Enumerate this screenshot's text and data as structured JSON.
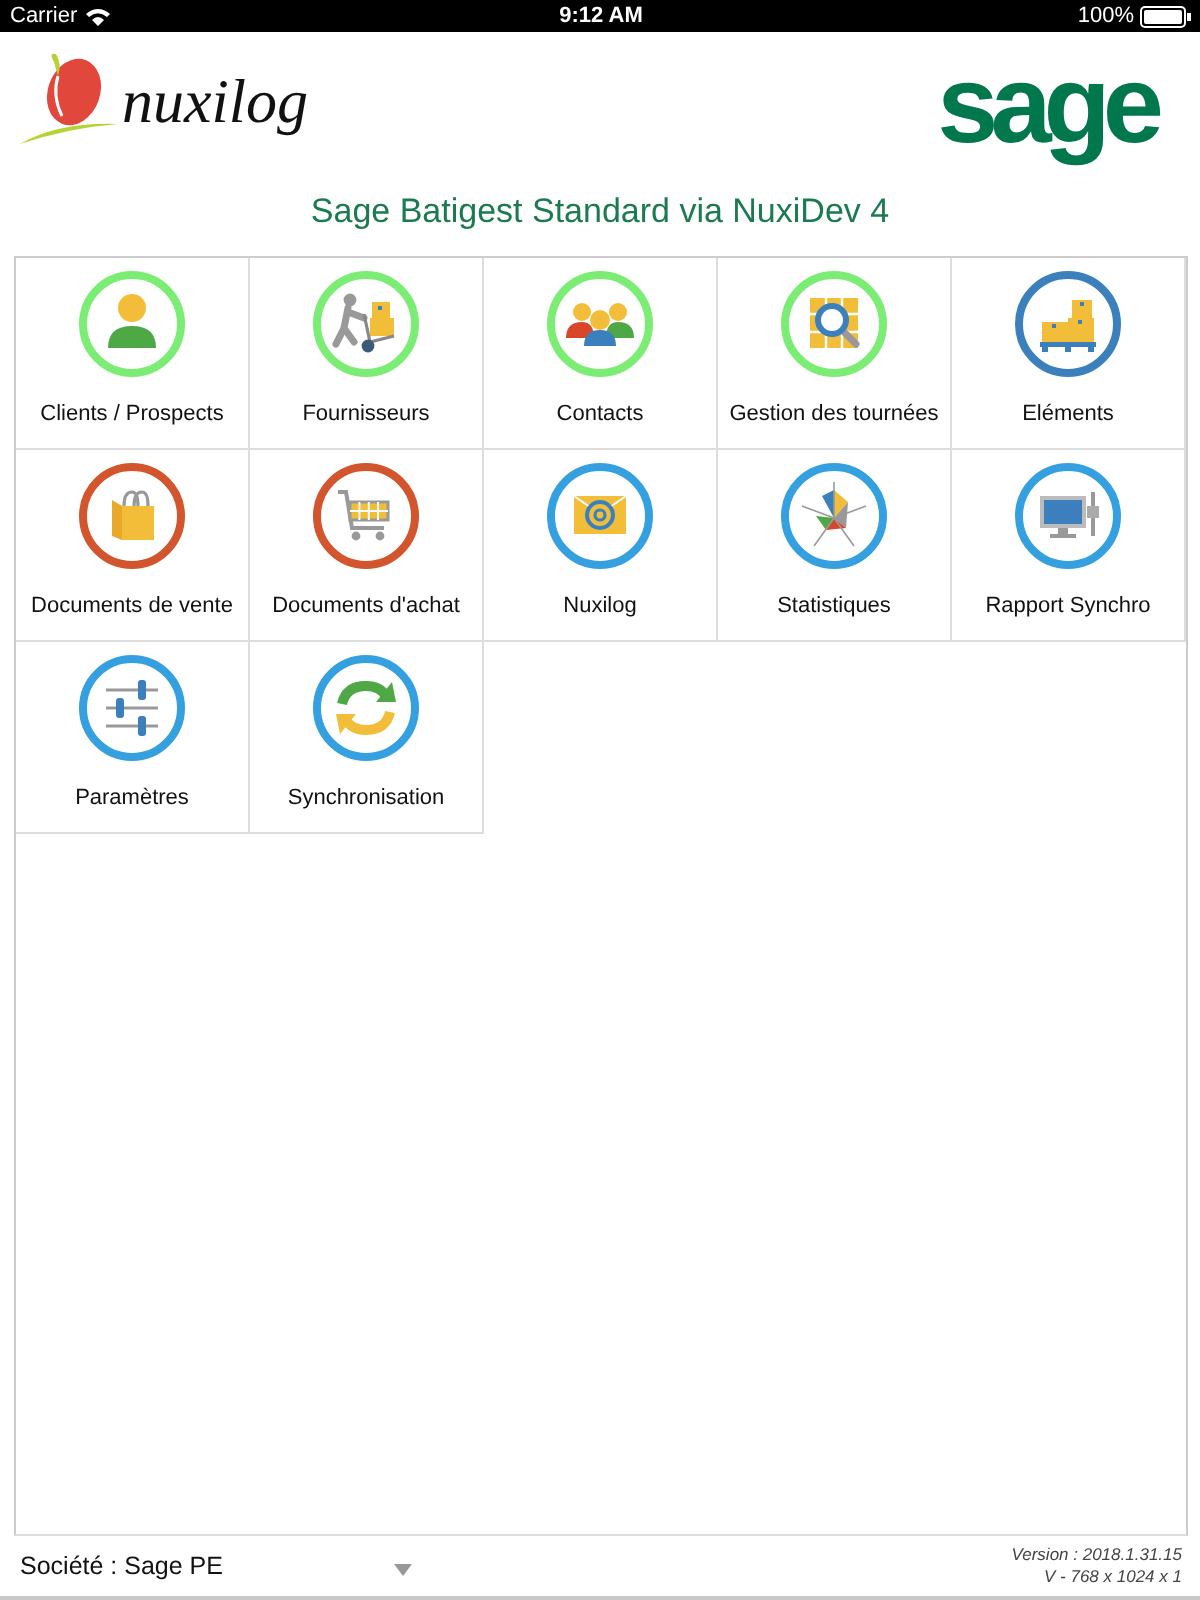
{
  "status_bar": {
    "carrier": "Carrier",
    "time": "9:12 AM",
    "battery": "100%"
  },
  "header": {
    "nuxilog_logo": "nuxilog",
    "sage_logo": "sage",
    "title": "Sage Batigest Standard via NuxiDev 4"
  },
  "menu": {
    "tiles": [
      {
        "label": "Clients / Prospects"
      },
      {
        "label": "Fournisseurs"
      },
      {
        "label": "Contacts"
      },
      {
        "label": "Gestion des tournées"
      },
      {
        "label": "Eléments"
      },
      {
        "label": "Documents de vente"
      },
      {
        "label": "Documents d'achat"
      },
      {
        "label": "Nuxilog"
      },
      {
        "label": "Statistiques"
      },
      {
        "label": "Rapport Synchro"
      },
      {
        "label": "Paramètres"
      },
      {
        "label": "Synchronisation"
      }
    ]
  },
  "footer": {
    "company": "Société : Sage PE",
    "version": "Version : 2018.1.31.15",
    "screen": "V - 768 x 1024 x 1"
  }
}
